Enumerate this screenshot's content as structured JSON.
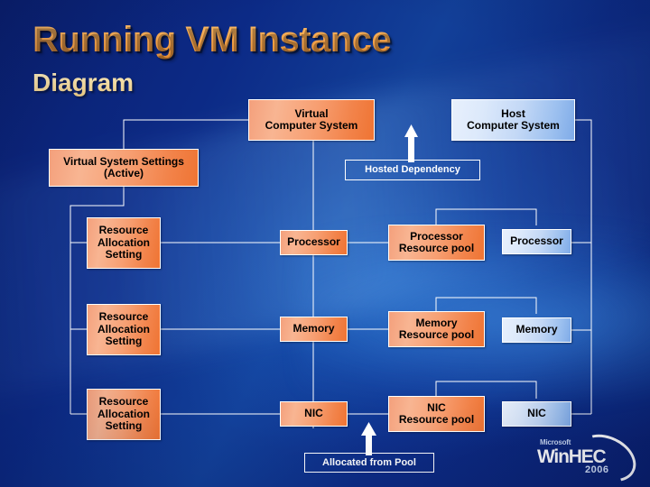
{
  "slide": {
    "title": "Running VM Instance",
    "subtitle": "Diagram",
    "background_color": "#0b2580",
    "title_color": "#f2a24a",
    "subtitle_color": "#f1d79b"
  },
  "boxes": {
    "virtual_computer_system": {
      "label": "Virtual\nComputer System",
      "style": "orange"
    },
    "host_computer_system": {
      "label": "Host\nComputer System",
      "style": "blue"
    },
    "hosted_dependency": {
      "label": "Hosted Dependency",
      "style": "plain"
    },
    "virtual_system_settings": {
      "label": "Virtual System Settings\n(Active)",
      "style": "orange"
    },
    "allocated_from_pool": {
      "label": "Allocated from Pool",
      "style": "plain"
    }
  },
  "rows": [
    {
      "name": "processor",
      "setting": {
        "label": "Resource\nAllocation\nSetting",
        "style": "orange"
      },
      "virtual": {
        "label": "Processor",
        "style": "orange"
      },
      "pool": {
        "label": "Processor\nResource pool",
        "style": "orange"
      },
      "host": {
        "label": "Processor",
        "style": "blue"
      }
    },
    {
      "name": "memory",
      "setting": {
        "label": "Resource\nAllocation\nSetting",
        "style": "orange"
      },
      "virtual": {
        "label": "Memory",
        "style": "orange"
      },
      "pool": {
        "label": "Memory\nResource pool",
        "style": "orange"
      },
      "host": {
        "label": "Memory",
        "style": "blue"
      }
    },
    {
      "name": "nic",
      "setting": {
        "label": "Resource\nAllocation\nSetting",
        "style": "orange"
      },
      "virtual": {
        "label": "NIC",
        "style": "orange"
      },
      "pool": {
        "label": "NIC\nResource pool",
        "style": "orange"
      },
      "host": {
        "label": "NIC",
        "style": "blue"
      }
    }
  ],
  "logo": {
    "vendor": "Microsoft",
    "name": "WinHEC",
    "year": "2006"
  }
}
